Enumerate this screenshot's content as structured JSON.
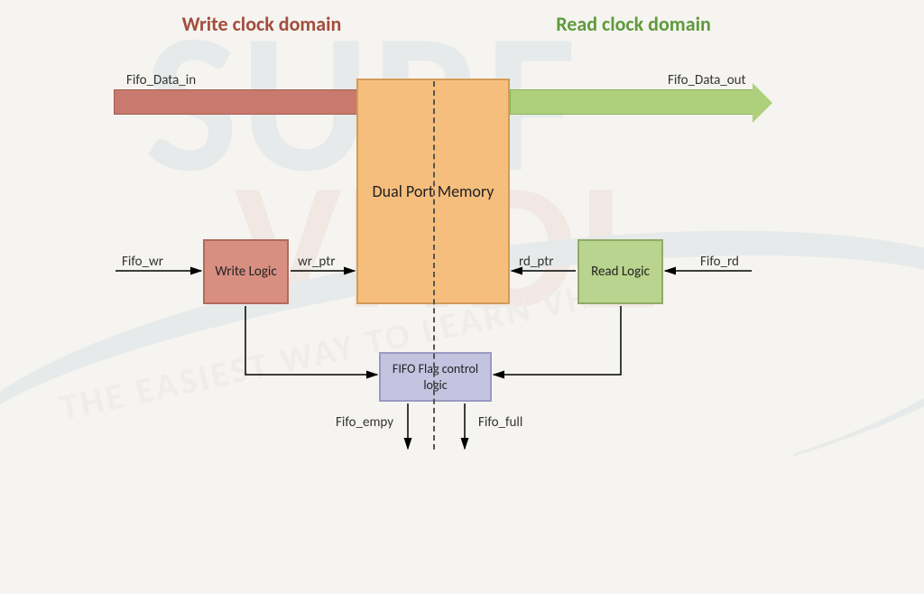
{
  "domains": {
    "write": "Write clock domain",
    "read": "Read clock domain"
  },
  "blocks": {
    "memory": "Dual Port Memory",
    "write_logic": "Write Logic",
    "read_logic": "Read Logic",
    "flag_logic": "FIFO Flag control logic"
  },
  "signals": {
    "data_in": "Fifo_Data_in",
    "data_out": "Fifo_Data_out",
    "fifo_wr": "Fifo_wr",
    "fifo_rd": "Fifo_rd",
    "wr_ptr": "wr_ptr",
    "rd_ptr": "rd_ptr",
    "fifo_empty": "Fifo_empy",
    "fifo_full": "Fifo_full"
  },
  "watermark": {
    "line1": "SURF",
    "line2": "VHDL",
    "tag": "THE EASIEST WAY TO LEARN VHDL"
  }
}
